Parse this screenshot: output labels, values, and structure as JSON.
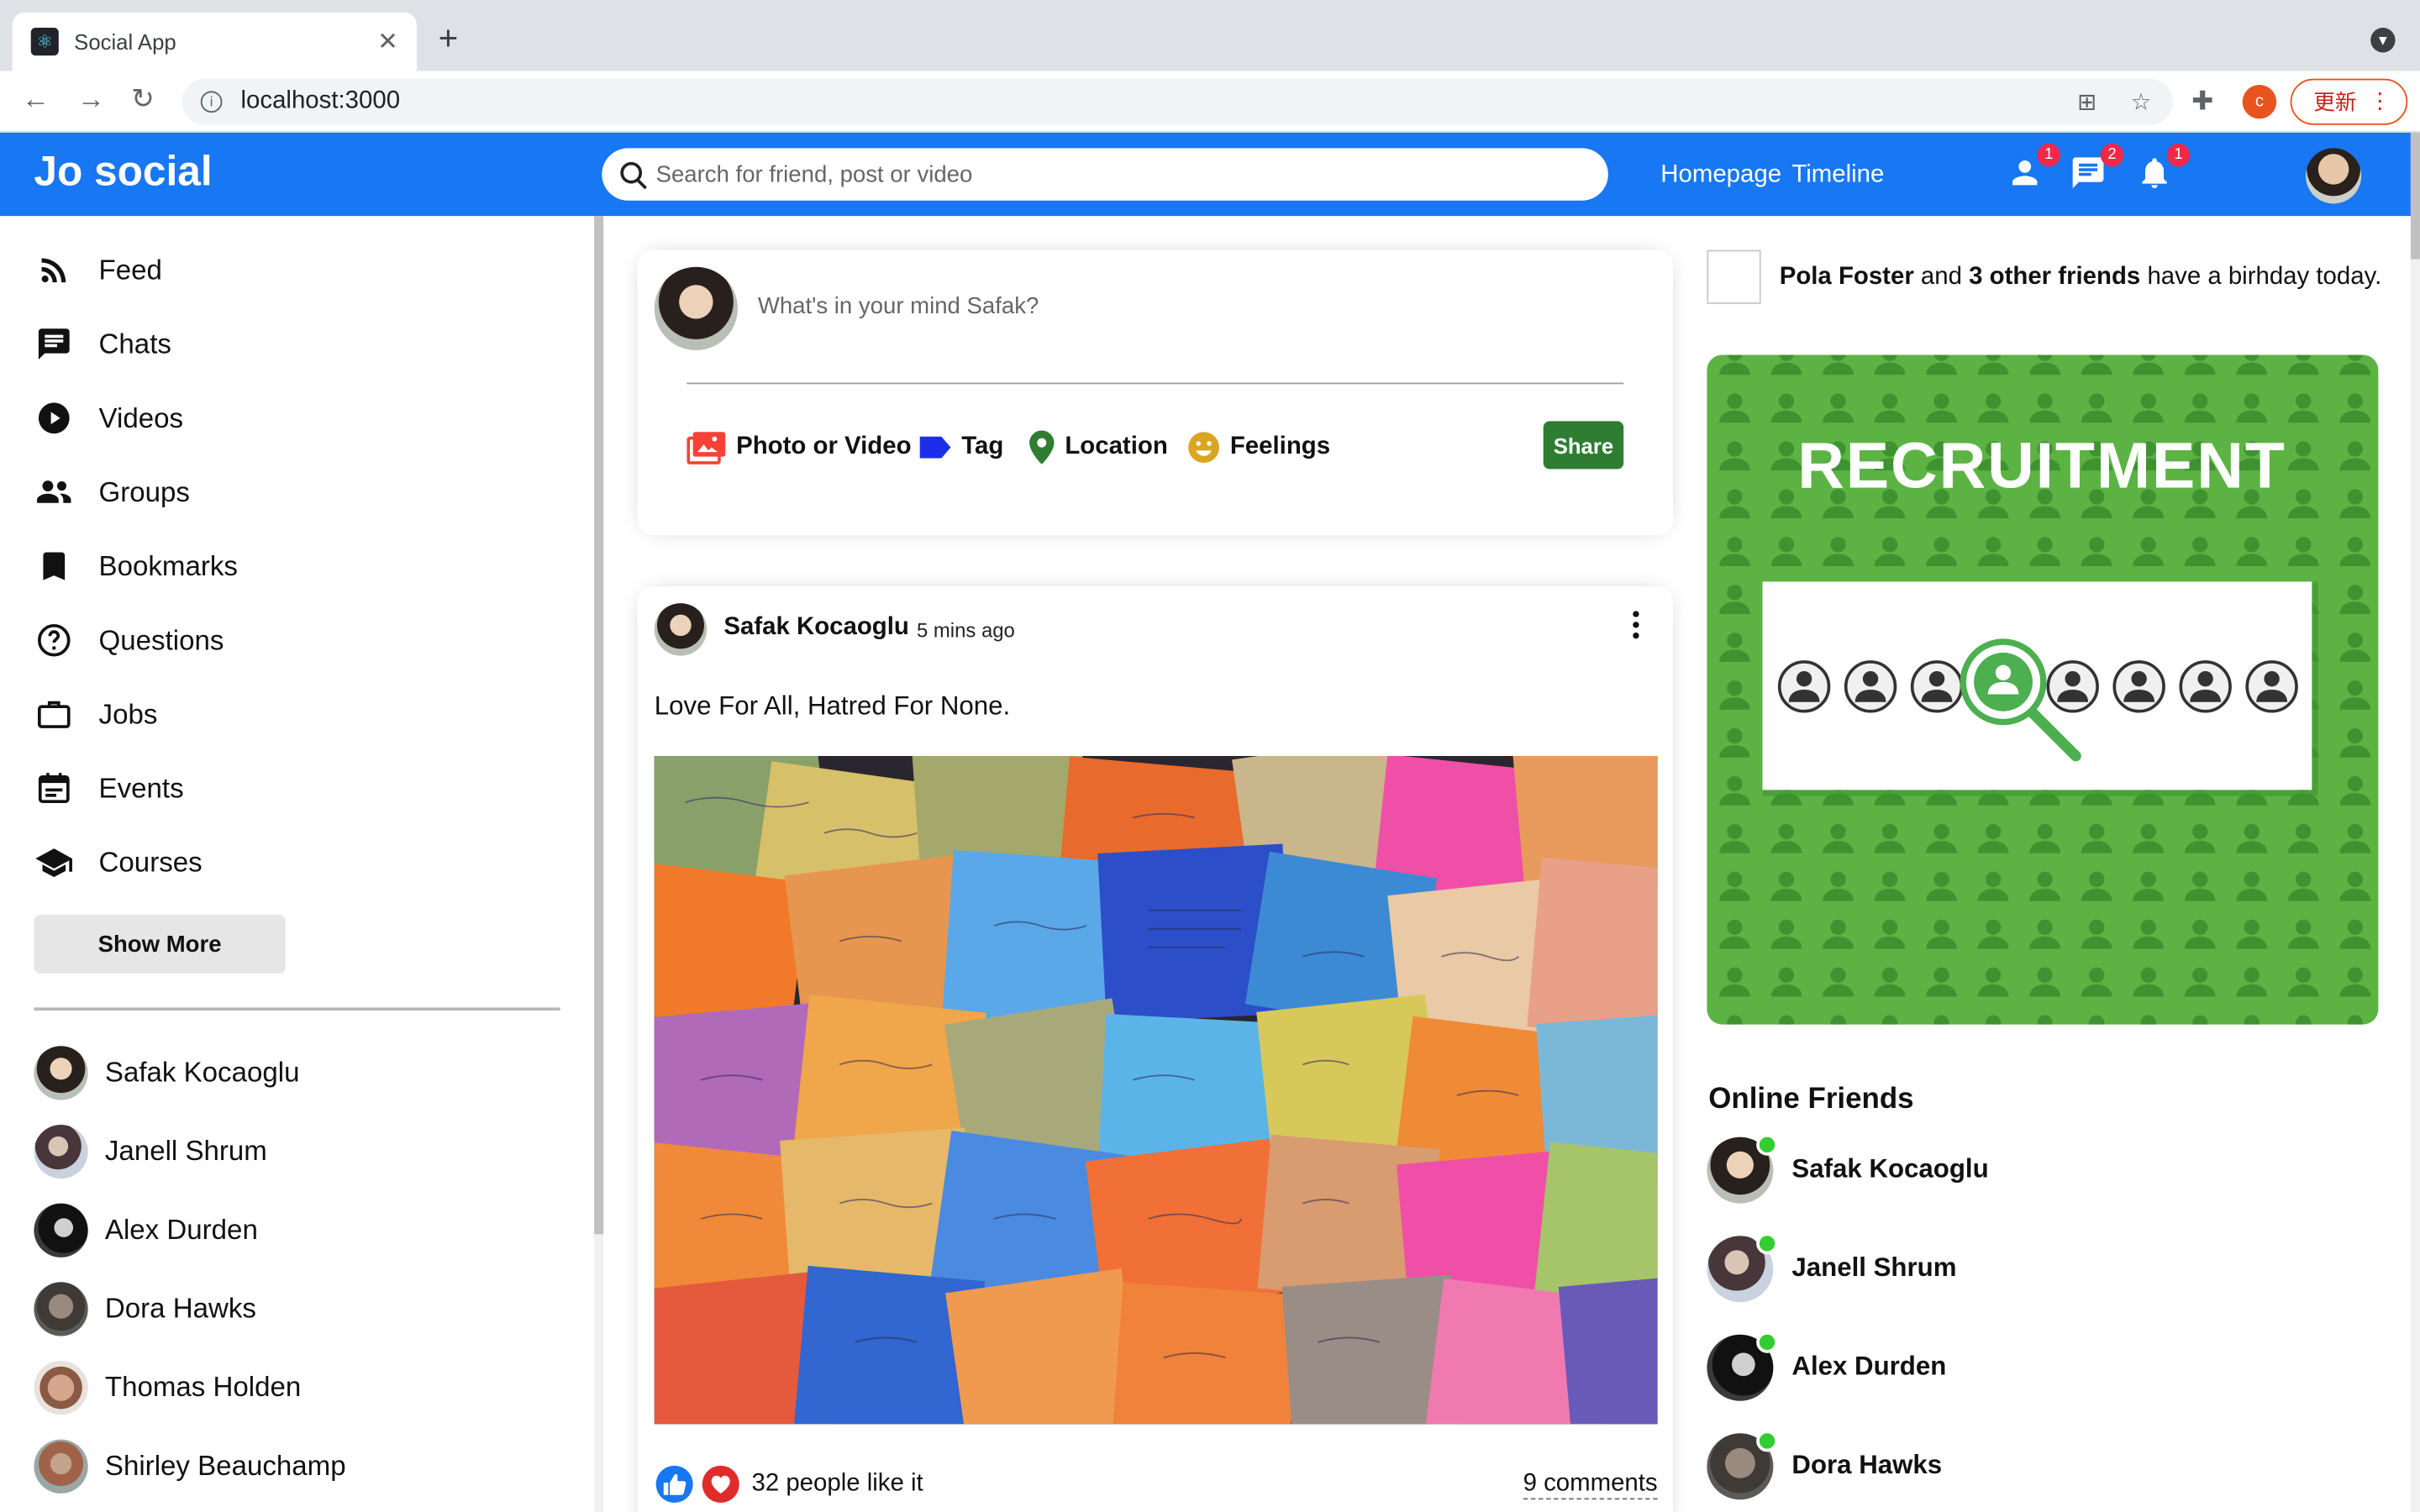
{
  "browser": {
    "tab_title": "Social App",
    "url": "localhost:3000",
    "update_label": "更新",
    "profile_initial": "c"
  },
  "topbar": {
    "logo": "Jo social",
    "search_placeholder": "Search for friend, post or video",
    "links": [
      "Homepage",
      "Timeline"
    ],
    "badges": {
      "friends": "1",
      "chats": "2",
      "notifications": "1"
    },
    "accent_color": "#1877f2"
  },
  "sidebar": {
    "items": [
      {
        "label": "Feed",
        "icon": "rss-feed-icon"
      },
      {
        "label": "Chats",
        "icon": "chat-icon"
      },
      {
        "label": "Videos",
        "icon": "play-circle-icon"
      },
      {
        "label": "Groups",
        "icon": "group-icon"
      },
      {
        "label": "Bookmarks",
        "icon": "bookmark-icon"
      },
      {
        "label": "Questions",
        "icon": "help-outline-icon"
      },
      {
        "label": "Jobs",
        "icon": "work-outline-icon"
      },
      {
        "label": "Events",
        "icon": "event-icon"
      },
      {
        "label": "Courses",
        "icon": "school-icon"
      }
    ],
    "show_more": "Show More",
    "friends": [
      "Safak Kocaoglu",
      "Janell Shrum",
      "Alex Durden",
      "Dora Hawks",
      "Thomas Holden",
      "Shirley Beauchamp"
    ]
  },
  "share": {
    "placeholder": "What's in your mind Safak?",
    "options": [
      {
        "label": "Photo or Video",
        "icon": "perm-media-icon",
        "color": "#f44336"
      },
      {
        "label": "Tag",
        "icon": "label-icon",
        "color": "#1e2ee8"
      },
      {
        "label": "Location",
        "icon": "room-icon",
        "color": "#2e7d32"
      },
      {
        "label": "Feelings",
        "icon": "emoji-emotions-icon",
        "color": "#daa520"
      }
    ],
    "share_button": "Share"
  },
  "post": {
    "username": "Safak Kocaoglu",
    "date": "5 mins ago",
    "text": "Love For All, Hatred For None.",
    "likes": "32 people like it",
    "comments": "9 comments"
  },
  "rightbar": {
    "birthday": {
      "name": "Pola Foster",
      "middle": " and ",
      "others": "3 other friends",
      "suffix": " have a birhday today."
    },
    "ad_title": "RECRUITMENT",
    "online_title": "Online Friends",
    "online_friends": [
      "Safak Kocaoglu",
      "Janell Shrum",
      "Alex Durden",
      "Dora Hawks"
    ]
  }
}
